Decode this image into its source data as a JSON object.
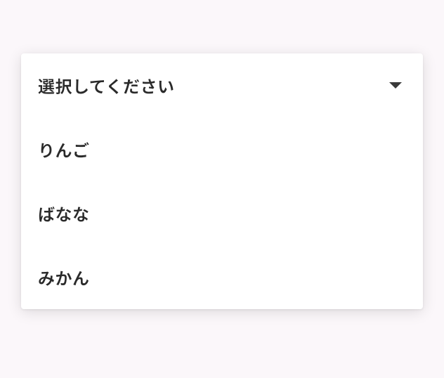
{
  "dropdown": {
    "placeholder": "選択してください",
    "options": [
      "りんご",
      "ばなな",
      "みかん"
    ]
  }
}
